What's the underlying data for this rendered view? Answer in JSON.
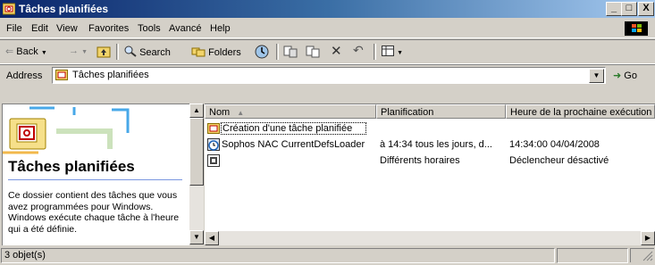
{
  "window": {
    "title": "Tâches planifiées",
    "minimize": "_",
    "maximize": "□",
    "close": "X"
  },
  "menu": [
    "File",
    "Edit",
    "View",
    "Favorites",
    "Tools",
    "Avancé",
    "Help"
  ],
  "toolbar": {
    "back": "Back",
    "search": "Search",
    "folders": "Folders"
  },
  "address": {
    "label": "Address",
    "value": "Tâches planifiées",
    "go": "Go"
  },
  "left_pane": {
    "title": "Tâches planifiées",
    "description": "Ce dossier contient des tâches que vous avez programmées pour Windows. Windows exécute chaque tâche à l'heure qui a été définie."
  },
  "list": {
    "columns": [
      "Nom",
      "Planification",
      "Heure de la prochaine exécution"
    ],
    "rows": [
      {
        "name": "Création d'une tâche planifiée",
        "schedule": "",
        "next_run": ""
      },
      {
        "name": "Sophos NAC CurrentDefsLoader",
        "schedule": "à 14:34 tous les jours, d...",
        "next_run": "14:34:00  04/04/2008"
      },
      {
        "name": "",
        "schedule": "Différents horaires",
        "next_run": "Déclencheur désactivé"
      }
    ]
  },
  "status": {
    "count": "3 objet(s)"
  },
  "colors": {
    "title_start": "#0a246a",
    "title_end": "#a6caf0",
    "face": "#d4d0c8"
  }
}
